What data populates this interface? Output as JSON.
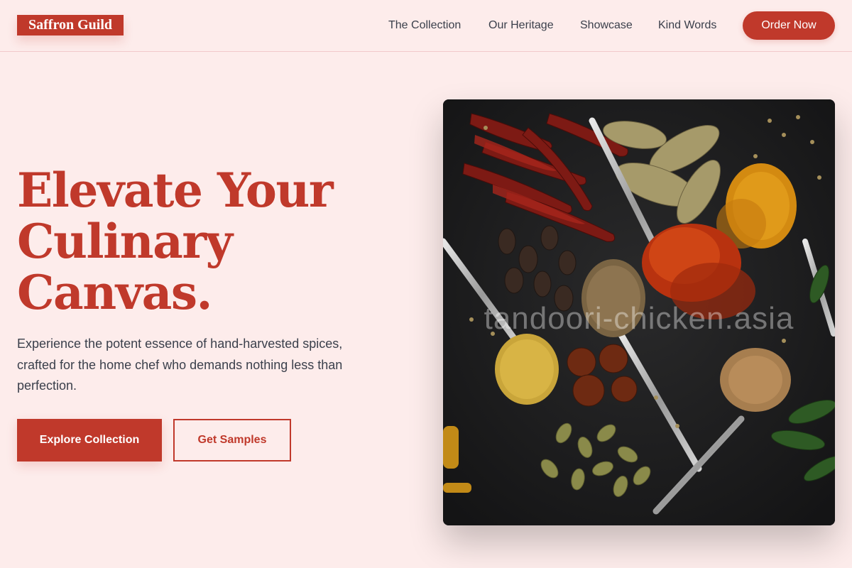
{
  "brand": {
    "name": "Saffron Guild"
  },
  "nav": {
    "links": [
      {
        "label": "The Collection"
      },
      {
        "label": "Our Heritage"
      },
      {
        "label": "Showcase"
      },
      {
        "label": "Kind Words"
      }
    ],
    "cta_label": "Order Now"
  },
  "hero": {
    "title_lines": [
      "Elevate Your",
      "Culinary",
      "Canvas."
    ],
    "description": "Experience the potent essence of hand-harvested spices, crafted for the home chef who demands nothing less than perfection.",
    "primary_button": "Explore Collection",
    "secondary_button": "Get Samples",
    "image_watermark": "tandoori-chicken.asia"
  },
  "colors": {
    "accent": "#c0392b",
    "background": "#fdeceb",
    "text": "#3a3f4b",
    "border": "#f2c9cb"
  }
}
